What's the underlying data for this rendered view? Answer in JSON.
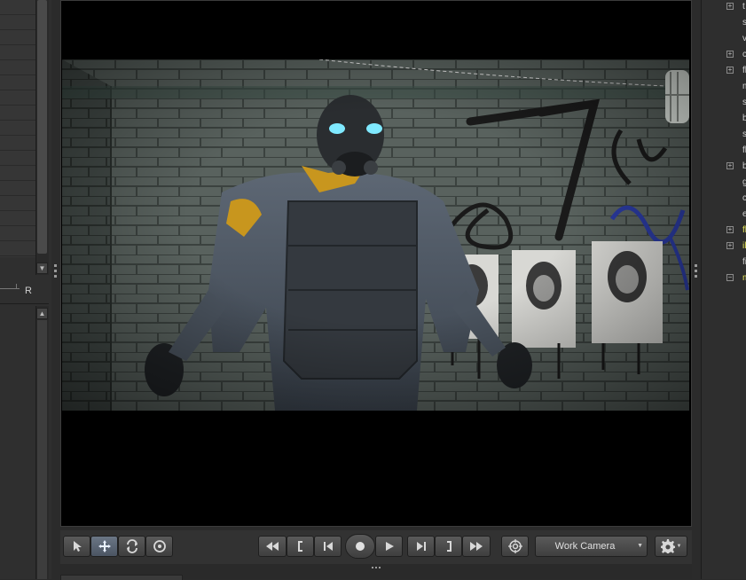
{
  "left_panel": {
    "slider_label": "R"
  },
  "viewport": {
    "scene_description_colors": {
      "wall": "#5a6460",
      "brick_line": "#3a403d",
      "armor": "#4a5460",
      "accent": "#c8961e",
      "eyes": "#7fe9ff"
    }
  },
  "toolbar": {
    "camera_select": "Work Camera",
    "icons": {
      "select": "arrow-pointer-icon",
      "move": "move-arrows-icon",
      "rotate": "rotate-icon",
      "scale": "scale-circle-icon",
      "rewind_fast": "fast-rewind-icon",
      "mark_in": "mark-in-bracket-icon",
      "skip_start": "skip-to-start-icon",
      "record": "record-icon",
      "play": "play-icon",
      "skip_end": "skip-to-end-icon",
      "mark_out": "mark-out-bracket-icon",
      "forward_fast": "fast-forward-icon",
      "target": "target-icon",
      "settings": "gear-icon"
    }
  },
  "right_panel": {
    "tree_items": [
      {
        "expander": "+",
        "text": "t",
        "color": "#cfcfcf"
      },
      {
        "expander": "",
        "text": "s",
        "color": "#cfcfcf"
      },
      {
        "expander": "",
        "text": "v",
        "color": "#cfcfcf"
      },
      {
        "expander": "+",
        "text": "c",
        "color": "#cfcfcf"
      },
      {
        "expander": "+",
        "text": "fl",
        "color": "#cfcfcf"
      },
      {
        "expander": "",
        "text": "m",
        "color": "#cfcfcf"
      },
      {
        "expander": "",
        "text": "s",
        "color": "#cfcfcf"
      },
      {
        "expander": "",
        "text": "b",
        "color": "#cfcfcf"
      },
      {
        "expander": "",
        "text": "s",
        "color": "#cfcfcf"
      },
      {
        "expander": "",
        "text": "fl",
        "color": "#cfcfcf"
      },
      {
        "expander": "+",
        "text": "b",
        "color": "#cfcfcf"
      },
      {
        "expander": "",
        "text": "g",
        "color": "#cfcfcf"
      },
      {
        "expander": "",
        "text": "c",
        "color": "#cfcfcf"
      },
      {
        "expander": "",
        "text": "e",
        "color": "#cfcfcf"
      },
      {
        "expander": "+",
        "text": "fl",
        "color": "#e6e65a"
      },
      {
        "expander": "+",
        "text": "ill",
        "color": "#e6e65a"
      },
      {
        "expander": "",
        "text": "fi",
        "color": "#cfcfcf"
      },
      {
        "expander": "−",
        "text": "m",
        "color": "#e6e65a"
      }
    ]
  }
}
